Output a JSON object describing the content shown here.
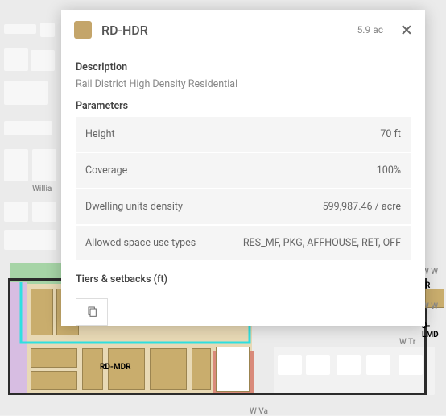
{
  "popup": {
    "title": "RD-HDR",
    "area": "5.9 ac",
    "description_label": "Description",
    "description": "Rail District High Density Residential",
    "parameters_label": "Parameters",
    "params": [
      {
        "label": "Height",
        "value": "70 ft"
      },
      {
        "label": "Coverage",
        "value": "100%"
      },
      {
        "label": "Dwelling units density",
        "value": "599,987.46 / acre"
      },
      {
        "label": "Allowed space use types",
        "value": "RES_MF, PKG, AFFHOUSE, RET, OFF"
      }
    ],
    "tiers_label": "Tiers & setbacks (ft)",
    "swatch_color": "#c4a56a"
  },
  "map": {
    "road_labels": {
      "willia": "Willia",
      "w_tr": "W Tr",
      "w_w1": "W W",
      "w_w2": "W W",
      "w_va": "W Va"
    },
    "zone_labels": {
      "rd_mdr": "RD-MDR",
      "d_lmd": "D-LMD",
      "r": "R"
    }
  }
}
